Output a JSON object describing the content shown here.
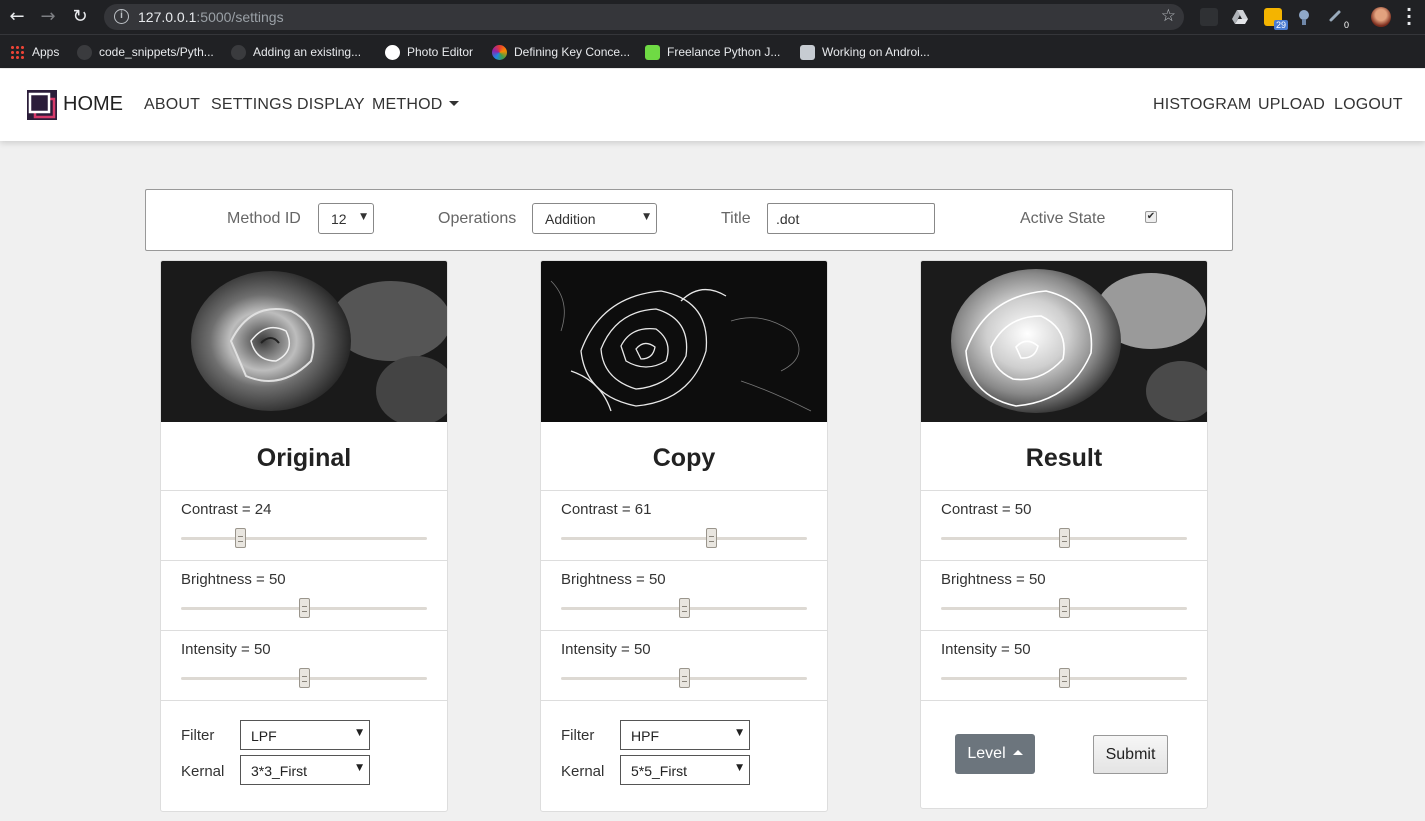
{
  "browser": {
    "url_host": "127.0.0.1",
    "url_path": ":5000/settings",
    "extension_badge": "29",
    "extension_badge_2": "0",
    "bookmarks": [
      "Apps",
      "code_snippets/Pyth...",
      "Adding an existing...",
      "Photo Editor",
      "Defining Key Conce...",
      "Freelance Python J...",
      "Working on Androi..."
    ]
  },
  "navbar": {
    "home": "HOME",
    "about": "ABOUT",
    "settings": "SETTINGS",
    "display": "DISPLAY",
    "method": "METHOD",
    "histogram": "HISTOGRAM",
    "upload": "UPLOAD",
    "logout": "LOGOUT"
  },
  "settings_bar": {
    "method_id_label": "Method ID",
    "method_id_value": "12",
    "operations_label": "Operations",
    "operations_value": "Addition",
    "title_label": "Title",
    "title_value": ".dot",
    "active_label": "Active State",
    "active_checked": true
  },
  "cards": [
    {
      "title": "Original",
      "contrast": "Contrast = 24",
      "contrast_value": 24,
      "brightness": "Brightness = 50",
      "brightness_value": 50,
      "intensity": "Intensity = 50",
      "intensity_value": 50,
      "filter_label": "Filter",
      "filter_value": "LPF",
      "kernal_label": "Kernal",
      "kernal_value": "3*3_First"
    },
    {
      "title": "Copy",
      "contrast": "Contrast = 61",
      "contrast_value": 61,
      "brightness": "Brightness = 50",
      "brightness_value": 50,
      "intensity": "Intensity = 50",
      "intensity_value": 50,
      "filter_label": "Filter",
      "filter_value": "HPF",
      "kernal_label": "Kernal",
      "kernal_value": "5*5_First"
    },
    {
      "title": "Result",
      "contrast": "Contrast = 50",
      "contrast_value": 50,
      "brightness": "Brightness = 50",
      "brightness_value": 50,
      "intensity": "Intensity = 50",
      "intensity_value": 50,
      "level_label": "Level",
      "submit_label": "Submit"
    }
  ]
}
